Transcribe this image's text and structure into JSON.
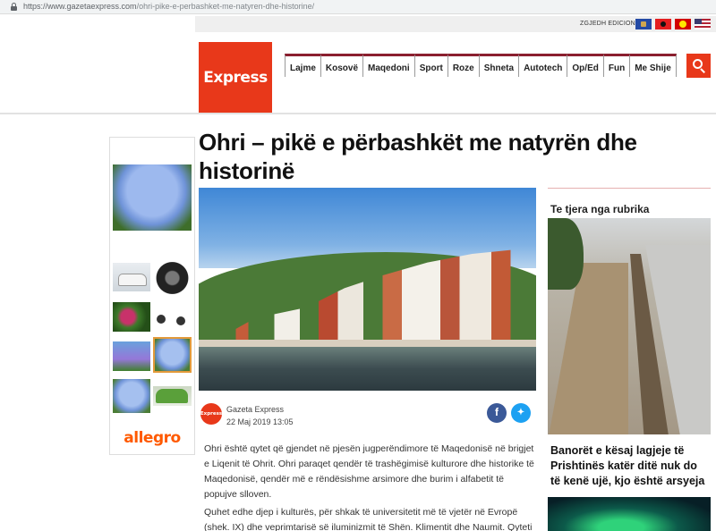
{
  "browser": {
    "url_host": "https://www.gazetaexpress.com",
    "url_path": "/ohri-pike-e-perbashket-me-natyren-dhe-historine/"
  },
  "edition": {
    "label": "ZGJEDH EDICIONIN",
    "flags": [
      "kosovo-flag",
      "albania-flag",
      "macedonia-flag",
      "usa-flag"
    ]
  },
  "header": {
    "logo": "Express",
    "nav": [
      "Lajme",
      "Kosovë",
      "Maqedoni",
      "Sport",
      "Roze",
      "Shneta",
      "Autotech",
      "Op/Ed",
      "Fun",
      "Me Shije"
    ],
    "accent_color": "#e8381a"
  },
  "ad": {
    "brand": "allegro"
  },
  "article": {
    "title": "Ohri – pikë e përbashkët me natyrën dhe historinë",
    "author": "Gazeta Express",
    "avatar_text": "Express",
    "date": "22 Maj 2019 13:05",
    "paragraphs": [
      "Ohri është qytet që gjendet në pjesën jugperëndimore të Maqedonisë në brigjet e Liqenit të Ohrit.  Ohri paraqet qendër të trashëgimisë kulturore dhe historike të Maqedonisë, qendër më e rëndësishme arsimore dhe burim i alfabetit të popujve slloven.",
      "Quhet edhe djep i kulturës, për shkak të universitetit më të vjetër në Evropë (shek. IX) dhe veprimtarisë së iluminizmit të Shën.  Klimentit dhe Naumit.  Qyteti është i njohur"
    ]
  },
  "sidebar": {
    "heading": "Te tjera nga rubrika",
    "story_title": "Banorët e kësaj lagjeje të Prishtinës katër ditë nuk do të kenë ujë, kjo është arsyeja"
  }
}
